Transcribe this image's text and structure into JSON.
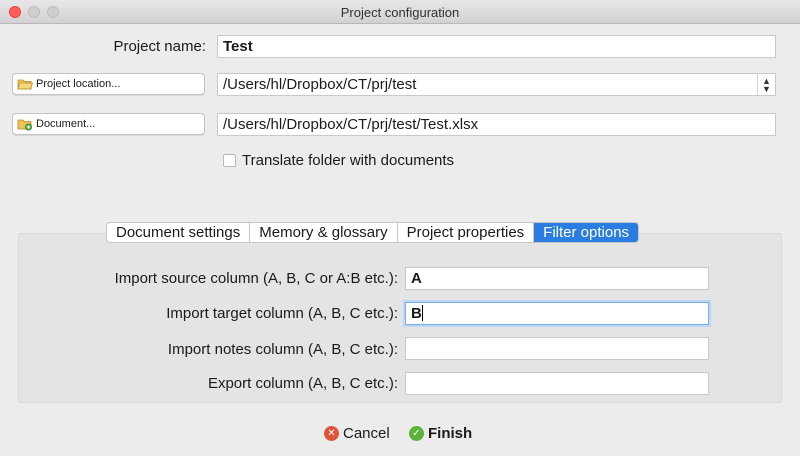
{
  "window": {
    "title": "Project configuration"
  },
  "form": {
    "project_name_label": "Project name:",
    "project_name_value": "Test",
    "project_location_button": "Project location...",
    "project_location_value": "/Users/hl/Dropbox/CT/prj/test",
    "document_button": "Document...",
    "document_value": "/Users/hl/Dropbox/CT/prj/test/Test.xlsx",
    "translate_folder_label": "Translate folder with documents",
    "translate_folder_checked": false
  },
  "tabs": [
    {
      "label": "Document settings",
      "active": false
    },
    {
      "label": "Memory & glossary",
      "active": false
    },
    {
      "label": "Project properties",
      "active": false
    },
    {
      "label": "Filter options",
      "active": true
    }
  ],
  "filter_options": {
    "source_column_label": "Import source column (A, B, C or A:B etc.):",
    "source_column_value": "A",
    "target_column_label": "Import target column (A, B, C etc.):",
    "target_column_value": "B",
    "notes_column_label": "Import notes column (A, B, C etc.):",
    "notes_column_value": "",
    "export_column_label": "Export column (A, B, C etc.):",
    "export_column_value": ""
  },
  "footer": {
    "cancel_label": "Cancel",
    "finish_label": "Finish"
  },
  "colors": {
    "accent": "#2a7de1",
    "cancel_icon": "#e0533d",
    "finish_icon": "#5bb33c"
  }
}
